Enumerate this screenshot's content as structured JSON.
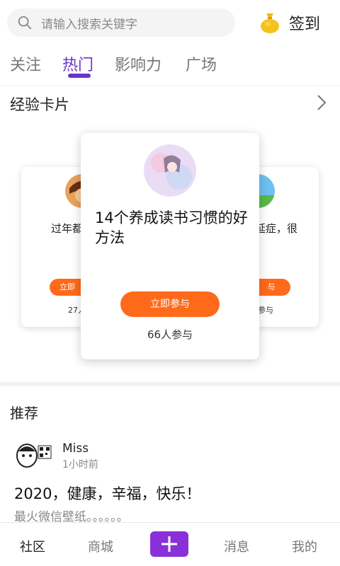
{
  "header": {
    "search_placeholder": "请输入搜索关键字",
    "signin_label": "签到"
  },
  "tabs": [
    {
      "label": "关注",
      "active": false
    },
    {
      "label": "热门",
      "active": true
    },
    {
      "label": "影响力",
      "active": false
    },
    {
      "label": "广场",
      "active": false
    }
  ],
  "section": {
    "title": "经验卡片"
  },
  "cards": {
    "left": {
      "text": "过年都",
      "button": "立即",
      "count": "27人"
    },
    "main": {
      "title": "14个养成读书习惯的好方法",
      "button": "立即参与",
      "count": "66人参与"
    },
    "right": {
      "text": "延症，很",
      "button": "与",
      "count": "参与"
    }
  },
  "recommend": {
    "title": "推荐",
    "post": {
      "user": "Miss",
      "time": "1小时前",
      "title": "2020，健康，辛福，快乐！",
      "subtitle": "最火微信壁纸。。。。。。"
    }
  },
  "nav": {
    "items": [
      "社区",
      "商城",
      "消息",
      "我的"
    ],
    "active": "社区"
  },
  "colors": {
    "accent": "#6b34c9",
    "orange": "#ff6a1a",
    "plus": "#8a30d9"
  }
}
